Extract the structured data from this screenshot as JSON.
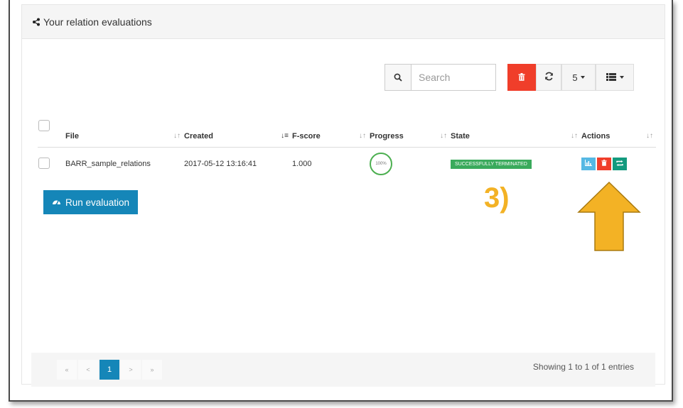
{
  "panel": {
    "title": "Your relation evaluations",
    "icon": "share-icon"
  },
  "toolbar": {
    "search_placeholder": "Search",
    "page_size": "5"
  },
  "table": {
    "headers": [
      "File",
      "Created",
      "F-score",
      "Progress",
      "State",
      "Actions"
    ],
    "rows": [
      {
        "file": "BARR_sample_relations",
        "created": "2017-05-12 13:16:41",
        "fscore": "1.000",
        "progress": "100%",
        "state": "SUCCESSFULLY TERMINATED"
      }
    ]
  },
  "run_button": {
    "label": "Run evaluation"
  },
  "annotation": {
    "label": "3)",
    "color": "#f3b225"
  },
  "pagination": {
    "first": "«",
    "prev": "<",
    "current": "1",
    "next": ">",
    "last": "»"
  },
  "footer": {
    "showing": "Showing 1 to 1 of 1 entries"
  },
  "colors": {
    "danger": "#f03e2a",
    "primary": "#1586b8",
    "success": "#3aaa5c",
    "info": "#55b8e3",
    "teal": "#139a7e"
  }
}
